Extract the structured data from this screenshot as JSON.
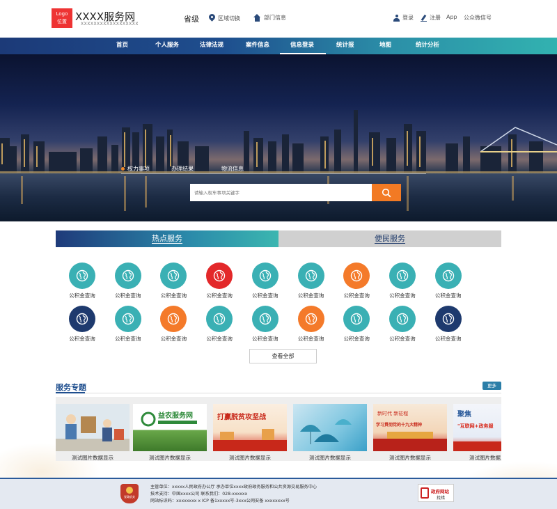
{
  "header": {
    "logo_line1": "Logo",
    "logo_line2": "位置",
    "site_title": "XXXX服务网",
    "site_subtitle": "XXXXXXXXXXXXXXXXXX",
    "province": "省级",
    "region_switch": "区域切换",
    "dept_info": "部门信息",
    "login": "登录",
    "register": "注册",
    "app": "App",
    "wechat": "公众微信号"
  },
  "nav": {
    "items": [
      "首页",
      "个人服务",
      "法律法规",
      "案件信息",
      "信息登录",
      "统计报表",
      "地图",
      "统计分析"
    ]
  },
  "banner": {
    "tabs": [
      "权力事项",
      "办理结果",
      "物流信息"
    ],
    "search_placeholder": "请输入权车事项关键字"
  },
  "services": {
    "tab_hot": "热点服务",
    "tab_convenience": "便民服务",
    "items": [
      {
        "label": "公积金查询",
        "color": "#3ab0b4"
      },
      {
        "label": "公积金查询",
        "color": "#3ab0b4"
      },
      {
        "label": "公积金查询",
        "color": "#3ab0b4"
      },
      {
        "label": "公积金查询",
        "color": "#e3282a"
      },
      {
        "label": "公积金查询",
        "color": "#3ab0b4"
      },
      {
        "label": "公积金查询",
        "color": "#3ab0b4"
      },
      {
        "label": "公积金查询",
        "color": "#f47a2a"
      },
      {
        "label": "公积金查询",
        "color": "#3ab0b4"
      },
      {
        "label": "公积金查询",
        "color": "#3ab0b4"
      },
      {
        "label": "公积金查询",
        "color": "#1e3a6e"
      },
      {
        "label": "公积金查询",
        "color": "#3ab0b4"
      },
      {
        "label": "公积金查询",
        "color": "#f47a2a"
      },
      {
        "label": "公积金查询",
        "color": "#3ab0b4"
      },
      {
        "label": "公积金查询",
        "color": "#3ab0b4"
      },
      {
        "label": "公积金查询",
        "color": "#f47a2a"
      },
      {
        "label": "公积金查询",
        "color": "#3ab0b4"
      },
      {
        "label": "公积金查询",
        "color": "#3ab0b4"
      },
      {
        "label": "公积金查询",
        "color": "#1e3a6e"
      }
    ],
    "view_all": "查看全部"
  },
  "topics": {
    "title": "服务专题",
    "more": "更多",
    "cards": [
      {
        "label": "测试图片数据显示"
      },
      {
        "label": "测试图片数据显示",
        "img_text": "益农服务网"
      },
      {
        "label": "测试图片数据显示",
        "img_text": "打赢脱贫攻坚战"
      },
      {
        "label": "测试图片数据显示"
      },
      {
        "label": "测试图片数据显示",
        "img_text": "学习贯彻党的十九大精神"
      },
      {
        "label": "测试图片数据显示",
        "img_text": "聚焦"
      }
    ]
  },
  "footer": {
    "line1": "主管单位：xxxxx人民政府办公厅    承办单位xxxx政府政务服务和公共资源交易服务中心",
    "line2": "技术支持：中国xxxx公司    联系我们：028-xxxxxx",
    "line3": "网站标识码：xxxxxxxx    x ICP 备1xxxxx号-3xxx公网安备 xxxxxxxx号",
    "emblem_text": "党政机关",
    "gov_badge_title": "政府网站",
    "gov_badge_sub": "找错"
  },
  "colors": {
    "nav_start": "#1c3a78",
    "nav_end": "#32b2b0",
    "teal": "#3ab0b4",
    "orange": "#f47a2a",
    "red": "#e3282a",
    "navy": "#1e3a6e"
  }
}
